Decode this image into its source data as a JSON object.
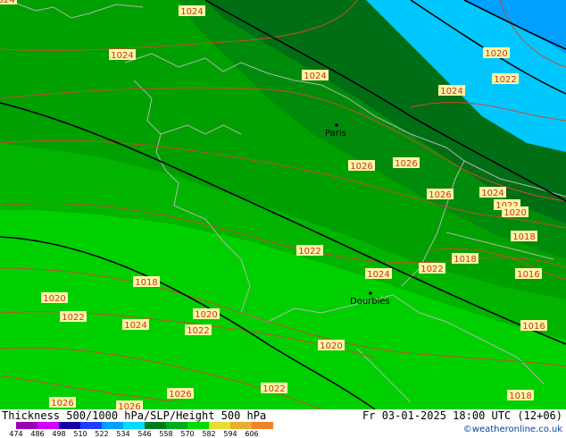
{
  "map": {
    "region": "France",
    "cities": [
      {
        "name": "Paris"
      },
      {
        "name": "Dourbies"
      }
    ],
    "isobar_labels": [
      "1024",
      "1024",
      "1024",
      "1024",
      "1020",
      "1022",
      "1024",
      "1026",
      "1026",
      "1026",
      "1024",
      "1022",
      "1020",
      "1018",
      "1022",
      "1024",
      "1022",
      "1018",
      "1016",
      "1018",
      "1020",
      "1022",
      "1024",
      "1022",
      "1020",
      "1020",
      "1016",
      "1026",
      "1026",
      "1026",
      "1022",
      "1018"
    ],
    "colors": {
      "isobar": "#c84a32",
      "height_contour": "#000000",
      "coast": "#b4b4b4",
      "label_bg": "#fff7a8",
      "label_text": "#c8321e"
    }
  },
  "footer": {
    "title": "Thickness 500/1000 hPa/SLP/Height 500 hPa",
    "valid_time": "Fr 03-01-2025 18:00 UTC (12+06)",
    "credit": "©weatheronline.co.uk",
    "scale_values": [
      "474",
      "486",
      "498",
      "510",
      "522",
      "534",
      "546",
      "558",
      "570",
      "582",
      "594",
      "606"
    ],
    "scale_colors": [
      "#9b00b4",
      "#d200ff",
      "#1400a0",
      "#1e3cff",
      "#00a0ff",
      "#00dcff",
      "#00781e",
      "#00aa1e",
      "#00dc00",
      "#e6dc32",
      "#e6af2d",
      "#f08228"
    ]
  }
}
